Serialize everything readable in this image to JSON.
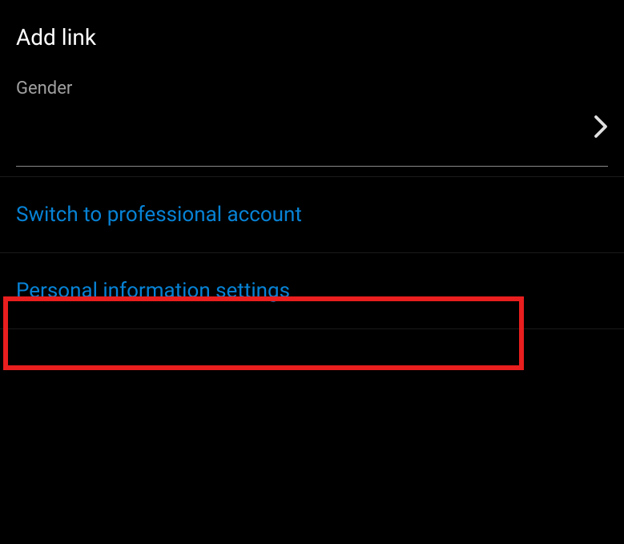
{
  "addLink": {
    "label": "Add link"
  },
  "gender": {
    "label": "Gender"
  },
  "switchAccount": {
    "label": "Switch to professional account"
  },
  "personalInfo": {
    "label": "Personal information settings"
  }
}
